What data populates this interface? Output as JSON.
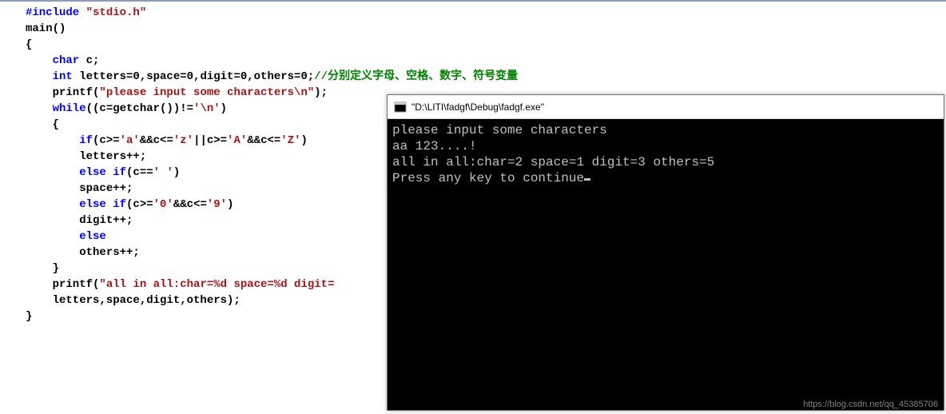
{
  "code": {
    "l1_pre": "#include ",
    "l1_str": "\"stdio.h\"",
    "l2": "main()",
    "l3": "{",
    "l4_kw": "    char",
    "l4_rest": " c;",
    "l5_kw": "    int",
    "l5_rest": " letters=0,space=0,digit=0,others=0;",
    "l5_comment": "//分别定义字母、空格、数字、符号变量",
    "l6_a": "    printf(",
    "l6_str": "\"please input some characters\\n\"",
    "l6_b": ");",
    "l7_kw": "    while",
    "l7_a": "((c=getchar())!=",
    "l7_str": "'\\n'",
    "l7_b": ")",
    "l8": "    {",
    "l9_kw": "        if",
    "l9_a": "(c>=",
    "l9_s1": "'a'",
    "l9_b": "&&c<=",
    "l9_s2": "'z'",
    "l9_c": "||c>=",
    "l9_s3": "'A'",
    "l9_d": "&&c<=",
    "l9_s4": "'Z'",
    "l9_e": ")",
    "l10": "        letters++;",
    "l11_kw": "        else if",
    "l11_a": "(c==",
    "l11_str": "' '",
    "l11_b": ")",
    "l12": "        space++;",
    "l13_kw": "        else if",
    "l13_a": "(c>=",
    "l13_s1": "'0'",
    "l13_b": "&&c<=",
    "l13_s2": "'9'",
    "l13_c": ")",
    "l14": "        digit++;",
    "l15_kw": "        else",
    "l16": "        others++;",
    "l17": "    }",
    "l18_a": "    printf(",
    "l18_str": "\"all in all:char=%d space=%d digit=",
    "l19": "    letters,space,digit,others);",
    "l20": "}"
  },
  "console": {
    "title": "\"D:\\LITI\\fadgf\\Debug\\fadgf.exe\"",
    "line1": "please input some characters",
    "line2": "aa 123....!",
    "line3": "all in all:char=2 space=1 digit=3 others=5",
    "line4": "Press any key to continue"
  },
  "watermark": "https://blog.csdn.net/qq_45385706"
}
